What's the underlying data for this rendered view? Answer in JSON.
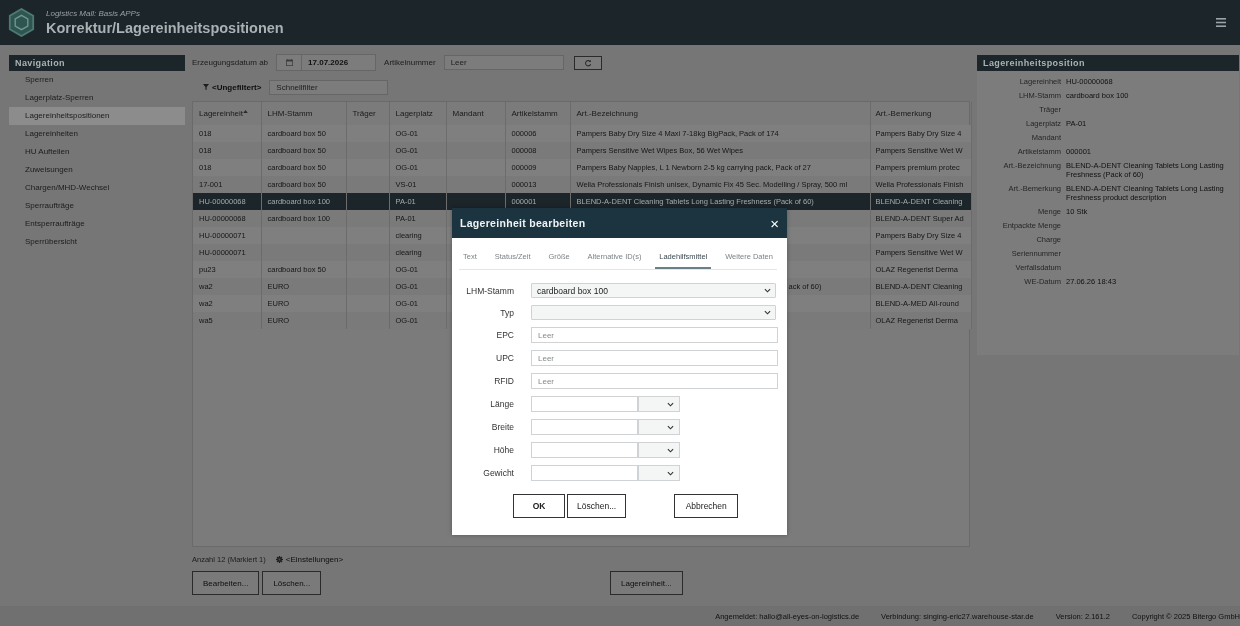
{
  "header": {
    "subtitle": "Logistics Mall: Basis APPs",
    "title": "Korrektur/Lagereinheitspositionen"
  },
  "navigation": {
    "title": "Navigation",
    "items": [
      {
        "label": "Sperren",
        "selected": false
      },
      {
        "label": "Lagerplatz-Sperren",
        "selected": false
      },
      {
        "label": "Lagereinheitspositionen",
        "selected": true
      },
      {
        "label": "Lagereinheiten",
        "selected": false
      },
      {
        "label": "HU Aufteilen",
        "selected": false
      },
      {
        "label": "Zuweisungen",
        "selected": false
      },
      {
        "label": "Chargen/MHD-Wechsel",
        "selected": false
      },
      {
        "label": "Sperraufträge",
        "selected": false
      },
      {
        "label": "Entsperraufträge",
        "selected": false
      },
      {
        "label": "Sperrübersicht",
        "selected": false
      }
    ]
  },
  "filters": {
    "date_label": "Erzeugungsdatum ab",
    "date_value": "17.07.2026",
    "article_label": "Artikelnummer",
    "article_placeholder": "Leer",
    "filter_label": "<Ungefiltert>",
    "quick_filter_placeholder": "Schnellfilter"
  },
  "table": {
    "columns": [
      {
        "label": "Lagereinheit",
        "sorted": true
      },
      {
        "label": "LHM-Stamm",
        "sorted": false
      },
      {
        "label": "Träger",
        "sorted": false
      },
      {
        "label": "Lagerplatz",
        "sorted": false
      },
      {
        "label": "Mandant",
        "sorted": false
      },
      {
        "label": "Artikelstamm",
        "sorted": false
      },
      {
        "label": "Art.-Bezeichnung",
        "sorted": false
      },
      {
        "label": "Art.-Bemerkung",
        "sorted": false
      }
    ],
    "rows": [
      {
        "selected": false,
        "lagereinheit": "018",
        "lhm_stamm": "cardboard box 50",
        "lagerplatz": "OG-01",
        "artikelstamm": "000006",
        "art_bezeichnung": "Pampers Baby Dry Size 4 Maxi 7-18kg BigPack, Pack of 174",
        "art_bemerkung": "Pampers Baby Dry Size 4"
      },
      {
        "selected": false,
        "lagereinheit": "018",
        "lhm_stamm": "cardboard box 50",
        "lagerplatz": "OG-01",
        "artikelstamm": "000008",
        "art_bezeichnung": "Pampers Sensitive Wet Wipes Box, 56 Wet Wipes",
        "art_bemerkung": "Pampers Sensitive Wet W"
      },
      {
        "selected": false,
        "lagereinheit": "018",
        "lhm_stamm": "cardboard box 50",
        "lagerplatz": "OG-01",
        "artikelstamm": "000009",
        "art_bezeichnung": "Pampers Baby Nappies, L 1 Newborn 2-5 kg carrying pack, Pack of 27",
        "art_bemerkung": "Pampers premium protec"
      },
      {
        "selected": false,
        "lagereinheit": "17-001",
        "lhm_stamm": "cardboard box 50",
        "lagerplatz": "VS-01",
        "artikelstamm": "000013",
        "art_bezeichnung": "Wella Professionals Finish unisex, Dynamic Fix 45 Sec. Modelling / Spray, 500 ml",
        "art_bemerkung": "Wella Professionals Finish"
      },
      {
        "selected": true,
        "lagereinheit": "HU-00000068",
        "lhm_stamm": "cardboard box 100",
        "lagerplatz": "PA-01",
        "artikelstamm": "000001",
        "art_bezeichnung": "BLEND-A-DENT Cleaning Tablets Long Lasting Freshness (Pack of 60)",
        "art_bemerkung": "BLEND-A-DENT Cleaning"
      },
      {
        "selected": false,
        "lagereinheit": "HU-00000068",
        "lhm_stamm": "cardboard box 100",
        "lagerplatz": "PA-01",
        "art_bemerkung": "BLEND-A-DENT Super Ad"
      },
      {
        "selected": false,
        "lagereinheit": "HU-00000071",
        "lagerplatz": "clearing",
        "art_bemerkung": "Pampers Baby Dry Size 4"
      },
      {
        "selected": false,
        "lagereinheit": "HU-00000071",
        "lagerplatz": "clearing",
        "art_bemerkung": "Pampers Sensitive Wet W"
      },
      {
        "selected": false,
        "lagereinheit": "pu23",
        "lhm_stamm": "cardboard box 50",
        "lagerplatz": "OG-01",
        "art_bemerkung": "OLAZ Regenerist Derma"
      },
      {
        "selected": false,
        "lagereinheit": "wa2",
        "lhm_stamm": "EURO",
        "lagerplatz": "OG-01",
        "art_bezeichnung_tail": "ack of 60)",
        "art_bemerkung": "BLEND-A-DENT Cleaning"
      },
      {
        "selected": false,
        "lagereinheit": "wa2",
        "lhm_stamm": "EURO",
        "lagerplatz": "OG-01",
        "art_bemerkung": "BLEND-A-MED All-round"
      },
      {
        "selected": false,
        "lagereinheit": "wa5",
        "lhm_stamm": "EURO",
        "lagerplatz": "OG-01",
        "art_bemerkung": "OLAZ Regenerist Derma"
      }
    ],
    "count": "Anzahl 12 (Markiert 1)",
    "settings": "<Einstellungen>"
  },
  "actions": {
    "left": [
      "Bearbeiten...",
      "Löschen..."
    ],
    "center": "Lagereinheit..."
  },
  "detail": {
    "title": "Lagereinheitsposition",
    "fields": [
      {
        "label": "Lagereinheit",
        "value": "HU-00000068"
      },
      {
        "label": "LHM-Stamm",
        "value": "cardboard box 100"
      },
      {
        "label": "Träger"
      },
      {
        "label": "Lagerplatz",
        "value": "PA-01"
      },
      {
        "label": "Mandant"
      },
      {
        "label": "Artikelstamm",
        "value": "000001"
      },
      {
        "label": "Art.-Bezeichnung",
        "value": "BLEND-A-DENT Cleaning Tablets Long Lasting Freshness (Pack of 60)"
      },
      {
        "label": "Art.-Bemerkung",
        "value": "BLEND-A-DENT Cleaning Tablets Long Lasting Freshness product description"
      },
      {
        "label": "Menge",
        "value": "10 Stk"
      },
      {
        "label": "Entpackte Menge"
      },
      {
        "label": "Charge"
      },
      {
        "label": "Seriennummer"
      },
      {
        "label": "Verfallsdatum"
      },
      {
        "label": "WE-Datum",
        "value": "27.06.26 18:43"
      }
    ]
  },
  "dialog": {
    "title": "Lagereinheit bearbeiten",
    "close": "×",
    "tabs": [
      {
        "label": "Text",
        "selected": false
      },
      {
        "label": "Status/Zeit",
        "selected": false
      },
      {
        "label": "Größe",
        "selected": false
      },
      {
        "label": "Alternative ID(s)",
        "selected": false
      },
      {
        "label": "Ladehilfsmittel",
        "selected": true
      },
      {
        "label": "Weitere Daten",
        "selected": false
      }
    ],
    "fields": [
      {
        "kind": "select",
        "label": "LHM-Stamm",
        "value": "cardboard box 100"
      },
      {
        "kind": "select",
        "label": "Typ"
      },
      {
        "kind": "input",
        "label": "EPC",
        "placeholder": "Leer"
      },
      {
        "kind": "input",
        "label": "UPC",
        "placeholder": "Leer"
      },
      {
        "kind": "input",
        "label": "RFID",
        "placeholder": "Leer"
      },
      {
        "kind": "measure",
        "label": "Länge"
      },
      {
        "kind": "measure",
        "label": "Breite"
      },
      {
        "kind": "measure",
        "label": "Höhe"
      },
      {
        "kind": "measure",
        "label": "Gewicht"
      }
    ],
    "buttons": [
      {
        "label": "OK",
        "kind": "primary"
      },
      {
        "label": "Löschen...",
        "kind": "normal"
      },
      {
        "label": "Abbrechen",
        "kind": "cancel"
      }
    ]
  },
  "status_bar": [
    "Angemeldet: hallo@all-eyes-on-logistics.de",
    "Verbindung: singing-eric27.warehouse-star.de",
    "Version: 2.161.2",
    "Copyright © 2025 Bitergo GmbH"
  ]
}
